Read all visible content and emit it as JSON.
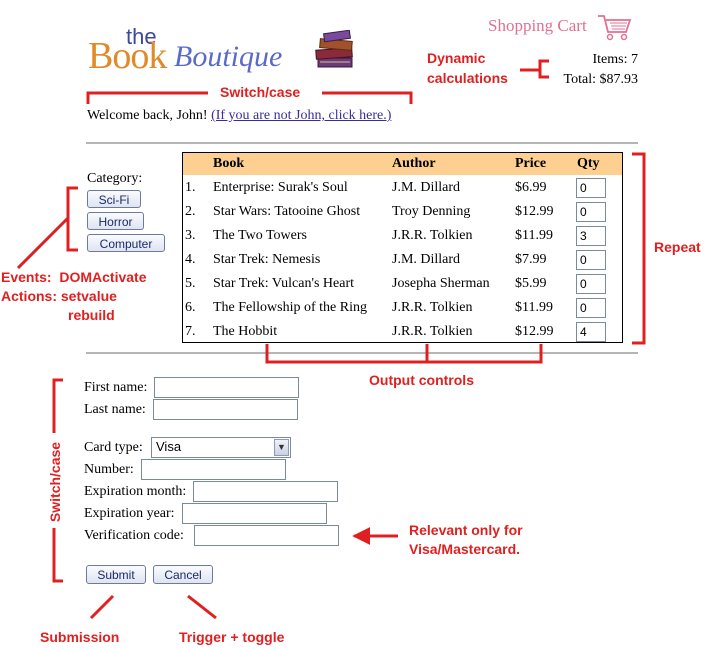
{
  "header": {
    "logo_the": "the",
    "logo_book": "Book",
    "logo_boutique": "Boutique",
    "cart_label": "Shopping Cart",
    "items_text": "Items: 7",
    "total_text": "Total: $87.93"
  },
  "welcome": {
    "text": "Welcome back, John!",
    "link": "(If you are not John, click here.)"
  },
  "category": {
    "label": "Category:",
    "buttons": [
      "Sci-Fi",
      "Horror",
      "Computer"
    ]
  },
  "table": {
    "headers": {
      "book": "Book",
      "author": "Author",
      "price": "Price",
      "qty": "Qty"
    },
    "rows": [
      {
        "num": "1.",
        "book": "Enterprise: Surak's Soul",
        "author": "J.M. Dillard",
        "price": "$6.99",
        "qty": "0"
      },
      {
        "num": "2.",
        "book": "Star Wars: Tatooine Ghost",
        "author": "Troy Denning",
        "price": "$12.99",
        "qty": "0"
      },
      {
        "num": "3.",
        "book": "The Two Towers",
        "author": "J.R.R. Tolkien",
        "price": "$11.99",
        "qty": "3"
      },
      {
        "num": "4.",
        "book": "Star Trek: Nemesis",
        "author": "J.M. Dillard",
        "price": "$7.99",
        "qty": "0"
      },
      {
        "num": "5.",
        "book": "Star Trek: Vulcan's Heart",
        "author": "Josepha Sherman",
        "price": "$5.99",
        "qty": "0"
      },
      {
        "num": "6.",
        "book": "The Fellowship of the Ring",
        "author": "J.R.R. Tolkien",
        "price": "$11.99",
        "qty": "0"
      },
      {
        "num": "7.",
        "book": "The Hobbit",
        "author": "J.R.R. Tolkien",
        "price": "$12.99",
        "qty": "4"
      }
    ]
  },
  "form": {
    "first_name": "First name:",
    "last_name": "Last name:",
    "card_type": "Card type:",
    "card_type_value": "Visa",
    "number": "Number:",
    "exp_month": "Expiration month:",
    "exp_year": "Expiration year:",
    "verification": "Verification code:",
    "submit": "Submit",
    "cancel": "Cancel"
  },
  "annotations": {
    "switch_top": "Switch/case",
    "dynamic_1": "Dynamic",
    "dynamic_2": "calculations",
    "repeat": "Repeat",
    "events_1": "Events:  DOMActivate",
    "events_2": "Actions: setvalue",
    "events_3": "rebuild",
    "output_controls": "Output controls",
    "switch_side": "Switch/case",
    "relevant_1": "Relevant only for",
    "relevant_2": "Visa/Mastercard.",
    "submission": "Submission",
    "trigger": "Trigger + toggle"
  },
  "colors": {
    "annotation": "#e02020",
    "table_header": "#fdcf91"
  },
  "icons": [
    "books-stack-icon",
    "shopping-cart-icon",
    "chevron-down-icon"
  ]
}
